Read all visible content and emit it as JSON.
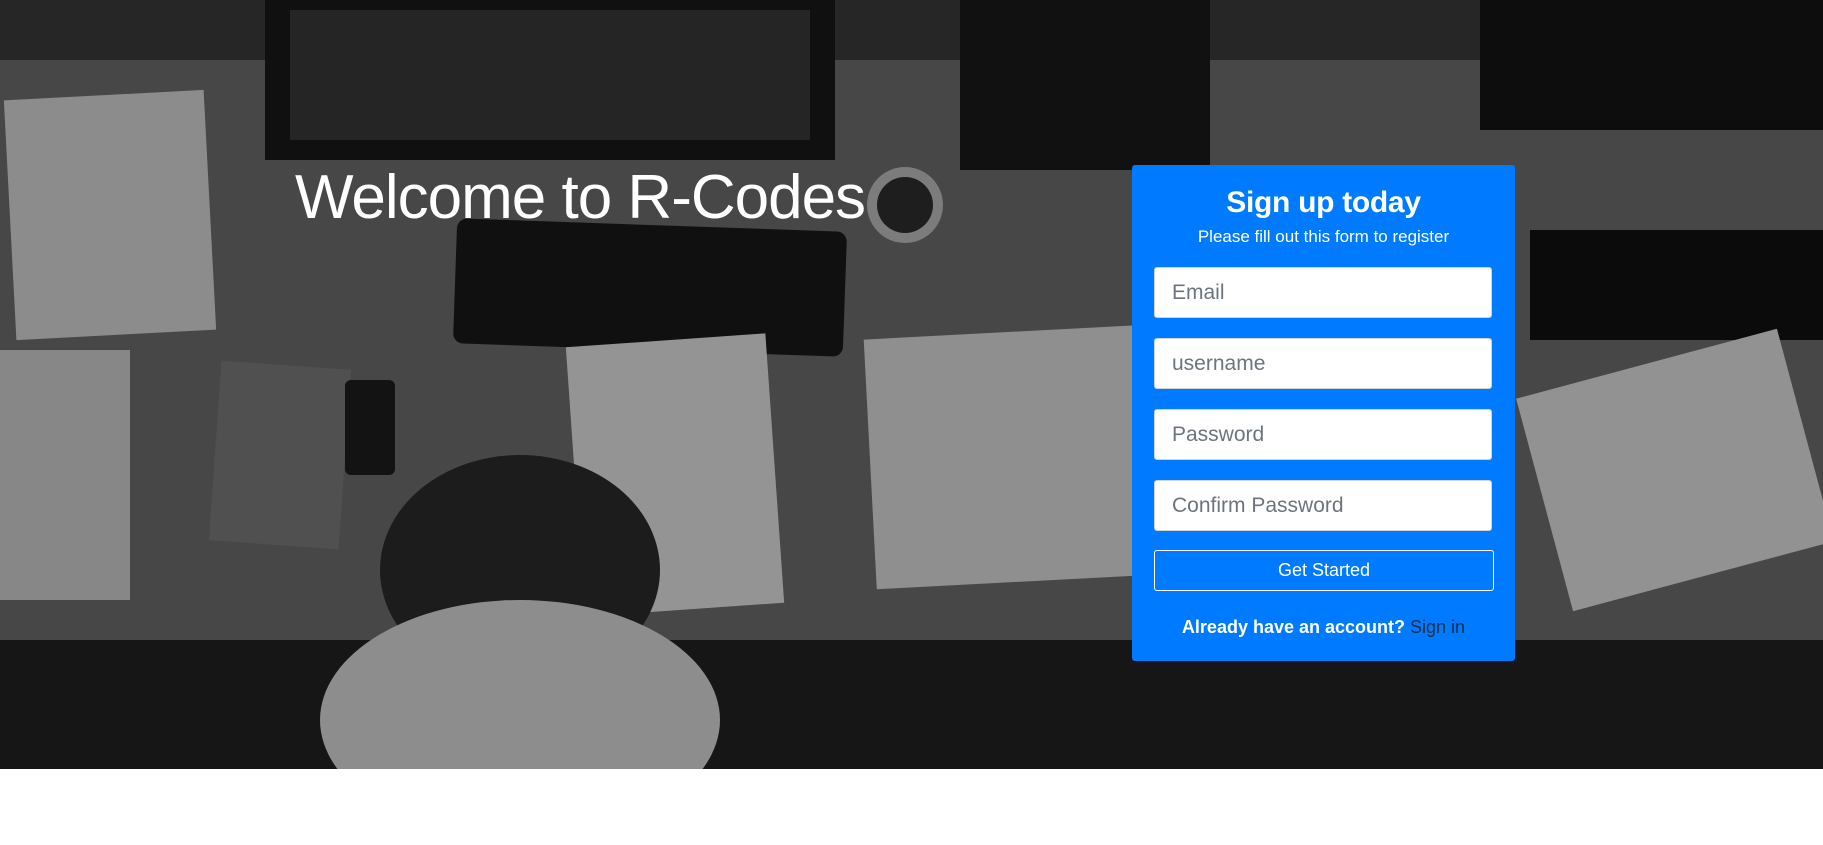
{
  "hero": {
    "heading": "Welcome to R-Codes"
  },
  "signup": {
    "title": "Sign up today",
    "subtitle": "Please fill out this form to register",
    "email_placeholder": "Email",
    "username_placeholder": "username",
    "password_placeholder": "Password",
    "confirm_password_placeholder": "Confirm Password",
    "submit_label": "Get Started",
    "account_prompt": "Already have an account?",
    "signin_label": "Sign in"
  },
  "colors": {
    "accent": "#007bff",
    "overlay": "#000000",
    "link": "#1d2f4a"
  }
}
